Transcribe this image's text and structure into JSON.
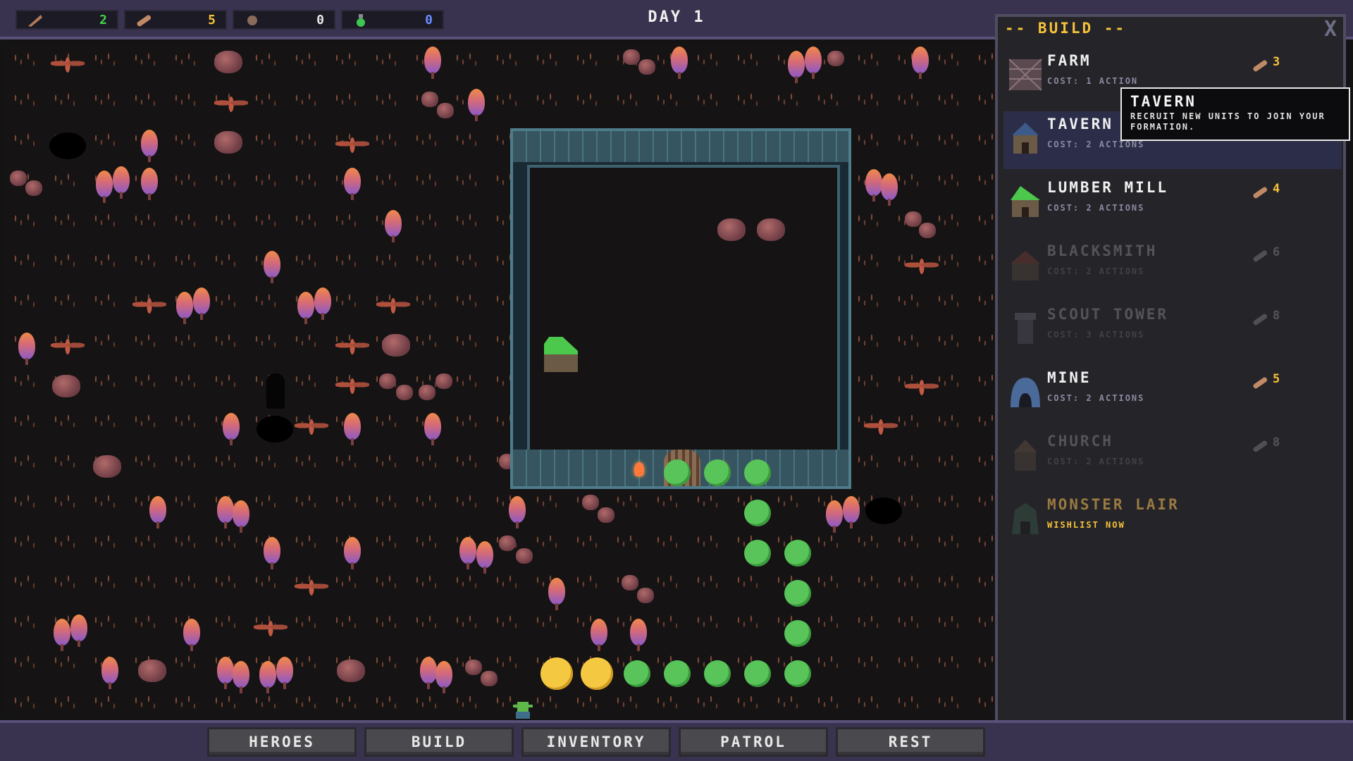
{
  "resources": [
    {
      "icon": "feather-icon",
      "value": "2",
      "color": "#43d64a"
    },
    {
      "icon": "log-icon",
      "value": "5",
      "color": "#f5c23a"
    },
    {
      "icon": "ore-icon",
      "value": "0",
      "color": "#e8e8e8"
    },
    {
      "icon": "potion-icon",
      "value": "0",
      "color": "#6a8cff"
    }
  ],
  "day_label": "DAY 1",
  "build_panel": {
    "title": "-- BUILD --",
    "close_glyph": "X",
    "items": [
      {
        "name": "FARM",
        "cost": "COST: 1 ACTION",
        "price": "3",
        "state": "available"
      },
      {
        "name": "TAVERN",
        "cost": "COST: 2 ACTIONS",
        "price": "",
        "state": "hovered"
      },
      {
        "name": "LUMBER MILL",
        "cost": "COST: 2 ACTIONS",
        "price": "4",
        "state": "available"
      },
      {
        "name": "BLACKSMITH",
        "cost": "COST: 2 ACTIONS",
        "price": "6",
        "state": "locked"
      },
      {
        "name": "SCOUT TOWER",
        "cost": "COST: 3 ACTIONS",
        "price": "8",
        "state": "locked"
      },
      {
        "name": "MINE",
        "cost": "COST: 2 ACTIONS",
        "price": "5",
        "state": "available"
      },
      {
        "name": "CHURCH",
        "cost": "COST: 2 ACTIONS",
        "price": "8",
        "state": "locked"
      },
      {
        "name": "MONSTER LAIR",
        "cost": "WISHLIST NOW",
        "price": "",
        "state": "promo"
      }
    ]
  },
  "tooltip": {
    "title": "TAVERN",
    "body": "RECRUIT NEW UNITS TO JOIN YOUR FORMATION."
  },
  "bottom_nav": [
    "HEROES",
    "BUILD",
    "INVENTORY",
    "PATROL",
    "REST"
  ],
  "colors": {
    "accent_gold": "#f5c23a",
    "path_green": "#58c45a",
    "path_gold": "#f5c842",
    "wall": "#4d7c8c"
  }
}
